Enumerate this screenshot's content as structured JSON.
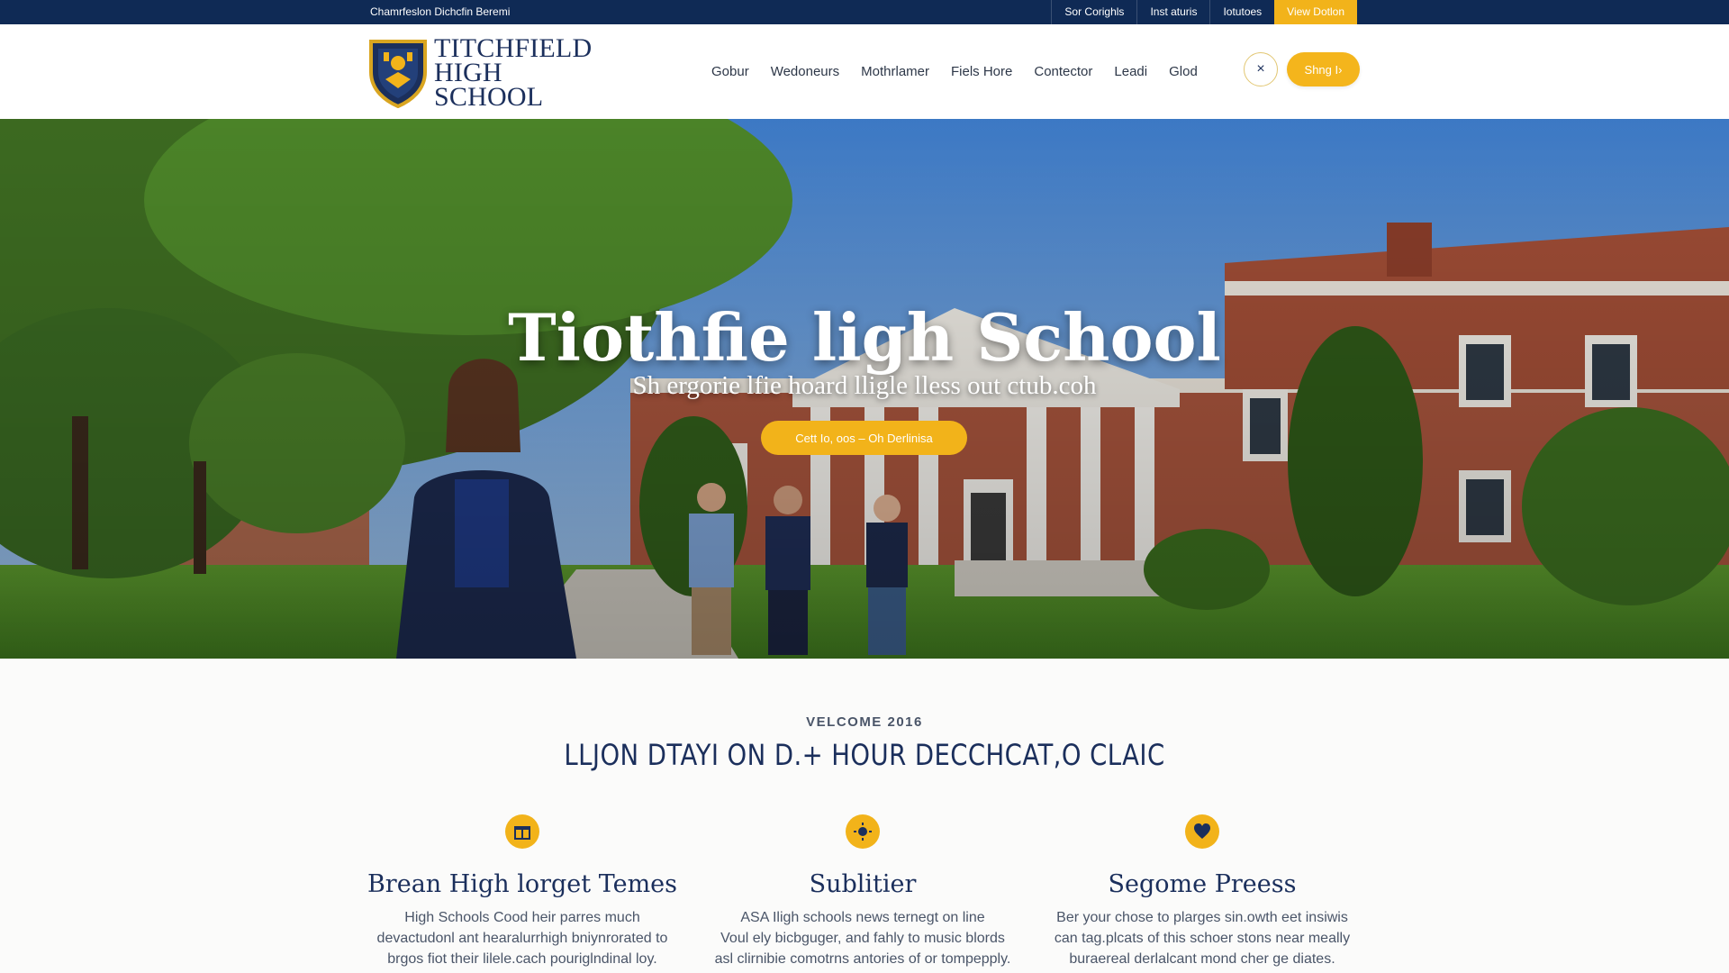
{
  "utility_bar": {
    "left_text": "Chamrfeslon Dichcfin Beremi",
    "links": [
      "Sor Corighls",
      "Inst aturis",
      "Iotutoes",
      "View Dotlon"
    ]
  },
  "header": {
    "logo": {
      "line1": "TITCHFIELD",
      "line2": "HIGH",
      "line3": "SCHOOL"
    },
    "nav": [
      "Gobur",
      "Wedoneurs",
      "Mothrlamer",
      "Fiels Hore",
      "Contector",
      "Leadi",
      "Glod"
    ],
    "close_symbol": "×",
    "cta_label": "Shng I›"
  },
  "hero": {
    "title": "Tiothfie ligh School",
    "subtitle": "Sh ergorie lfie hoard lligle lless out ctub.coh",
    "button_label": "Cett Io, oos – Oh Derlinisa"
  },
  "welcome": {
    "eyebrow": "VELCOME 2016",
    "heading": "LLJON DTAYI ON D.+ HOUR DECCHCAT,O CLAIC",
    "features": [
      {
        "icon": "gift-icon",
        "title": "Brean High lorget Temes",
        "text": [
          "High Schools Cood heir parres much",
          "devactudonl ant hearalurrhigh bniynrorated to",
          "brgos fiot their lilele.cach pouriglndinal loy."
        ]
      },
      {
        "icon": "sun-icon",
        "title": "Sublitier",
        "text": [
          "ASA Iligh schools news ternegt on line",
          "Voul ely bicbguger, and fahly to music blords",
          "asl clirnibie comotrns antories of or tompepply."
        ]
      },
      {
        "icon": "heart-icon",
        "title": "Segome Preess",
        "text": [
          "Ber your chose to plarges sin.owth eet insiwis",
          "can tag.plcats of this schoer stons near meally",
          "buraereal derlalcant mond cher ge diates."
        ]
      }
    ]
  },
  "colors": {
    "navy": "#0f2a55",
    "gold": "#f2b31a",
    "brick": "#a9553d"
  }
}
